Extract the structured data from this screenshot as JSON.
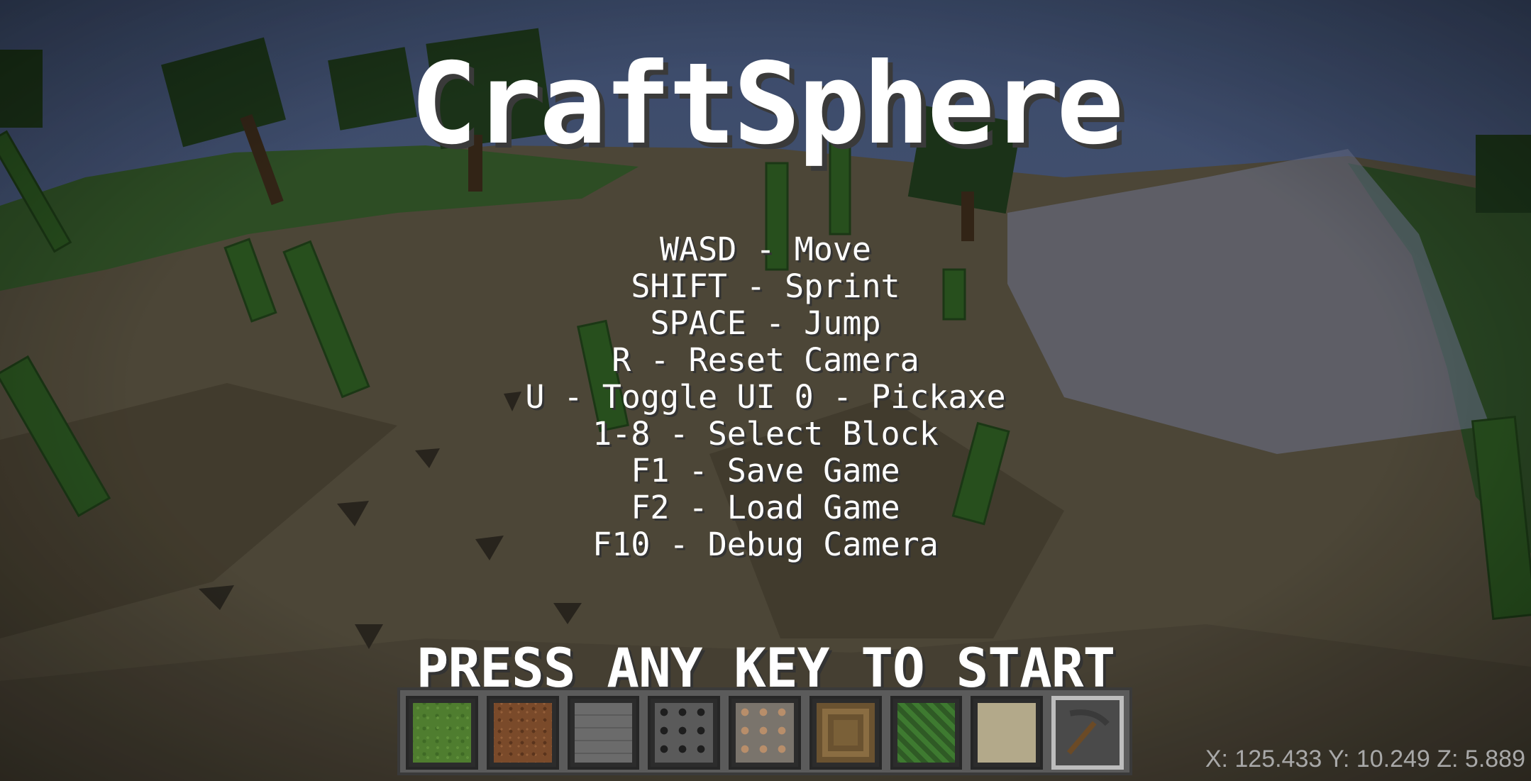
{
  "game": {
    "title": "CraftSphere",
    "controls": [
      "WASD - Move",
      "SHIFT - Sprint",
      "SPACE - Jump",
      "R - Reset Camera",
      "U - Toggle UI 0 - Pickaxe",
      "1-8 - Select Block",
      "F1 - Save Game",
      "F2 - Load Game",
      "F10 - Debug Camera"
    ],
    "start_prompt": "PRESS ANY KEY TO START"
  },
  "hotbar": {
    "slots": [
      {
        "block": "grass",
        "color": "#4f7d2f"
      },
      {
        "block": "dirt",
        "color": "#7a4a2a"
      },
      {
        "block": "stone",
        "color": "#6b6b6b"
      },
      {
        "block": "coal-ore",
        "color": "#5a5a5a"
      },
      {
        "block": "iron-ore",
        "color": "#8a7a6a"
      },
      {
        "block": "wood-planks",
        "color": "#7a6038"
      },
      {
        "block": "leaves",
        "color": "#2f5a25"
      },
      {
        "block": "sand",
        "color": "#b3a98a"
      },
      {
        "block": "pickaxe",
        "color": "#4a4a4a",
        "selected": true
      }
    ]
  },
  "debug": {
    "coords": "X: 125.433 Y: 10.249 Z: 5.889"
  },
  "colors": {
    "sky": "#4a5a82",
    "ground": "#57503f",
    "grass": "#34582a",
    "cactus": "#2d5a22"
  }
}
